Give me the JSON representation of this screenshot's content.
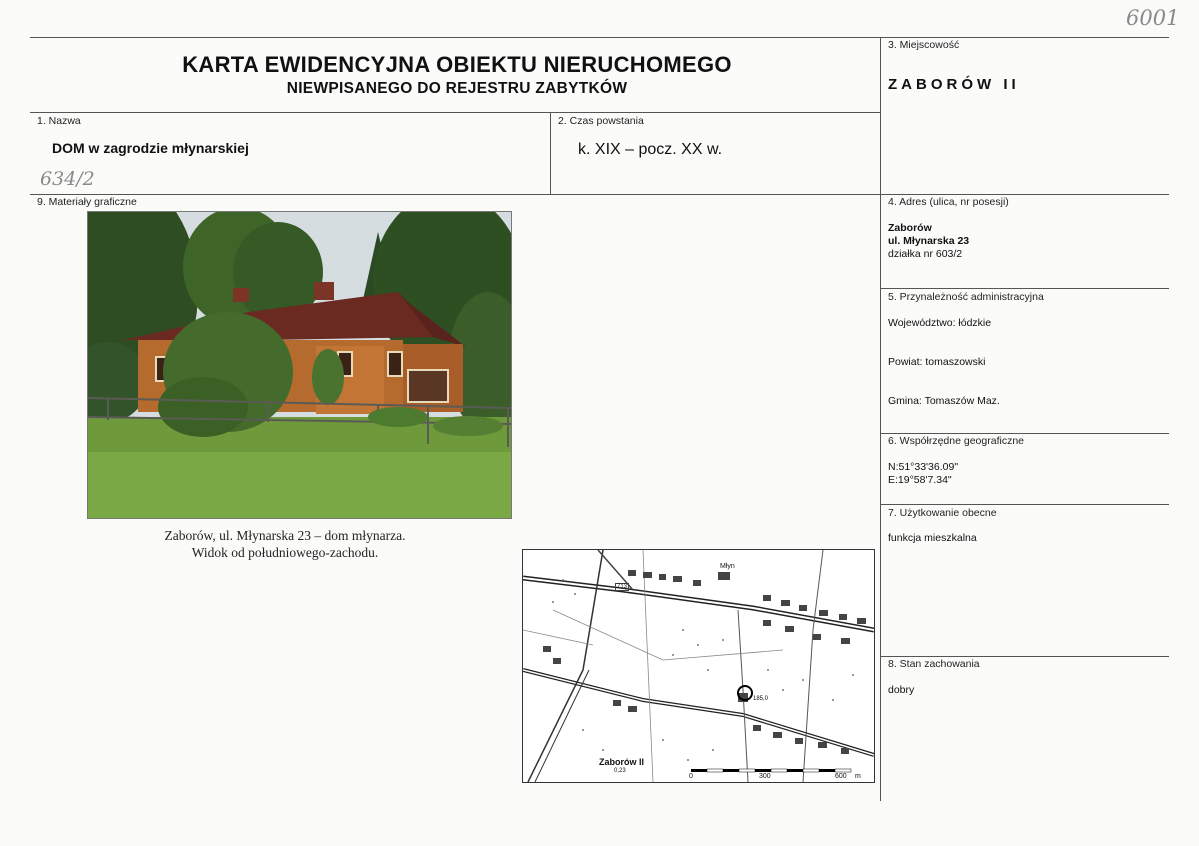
{
  "handwritten": {
    "catalog_no": "6001",
    "parcel_note": "634/2"
  },
  "header": {
    "title": "KARTA EWIDENCYJNA OBIEKTU NIERUCHOMEGO",
    "subtitle": "NIEWPISANEGO DO REJESTRU ZABYTKÓW"
  },
  "fields": {
    "nazwa": {
      "label": "1. Nazwa",
      "value": "DOM w zagrodzie młynarskiej"
    },
    "czas": {
      "label": "2. Czas powstania",
      "value": "k. XIX – pocz. XX w."
    },
    "miejscowosc": {
      "label": "3. Miejscowość",
      "value": "ZABORÓW II"
    },
    "adres": {
      "label": "4. Adres (ulica, nr posesji)",
      "lines": [
        "Zaborów",
        "ul. Młynarska 23",
        "działka nr 603/2"
      ]
    },
    "przynaleznosc": {
      "label": "5. Przynależność administracyjna",
      "wojewodztwo": "Województwo: łódzkie",
      "powiat": "Powiat: tomaszowski",
      "gmina": "Gmina: Tomaszów Maz."
    },
    "wspolrzedne": {
      "label": "6. Współrzędne geograficzne",
      "n": "N:51°33'36.09\"",
      "e": "E:19°58'7.34\""
    },
    "uzytkowanie": {
      "label": "7. Użytkowanie obecne",
      "value": "funkcja mieszkalna"
    },
    "stan": {
      "label": "8. Stan zachowania",
      "value": "dobry"
    },
    "materialy": {
      "label": "9. Materiały graficzne"
    }
  },
  "photo": {
    "caption_line1": "Zaborów, ul. Młynarska 23 – dom młynarza.",
    "caption_line2": "Widok od południowego-zachodu."
  },
  "map": {
    "place_label": "Zaborów II",
    "place_sub": "0,23",
    "scale_labels": [
      "0",
      "300",
      "600"
    ],
    "scale_unit": "m",
    "labels": {
      "road_no": "713",
      "elevation": "185,0",
      "mill": "Młyn"
    }
  }
}
